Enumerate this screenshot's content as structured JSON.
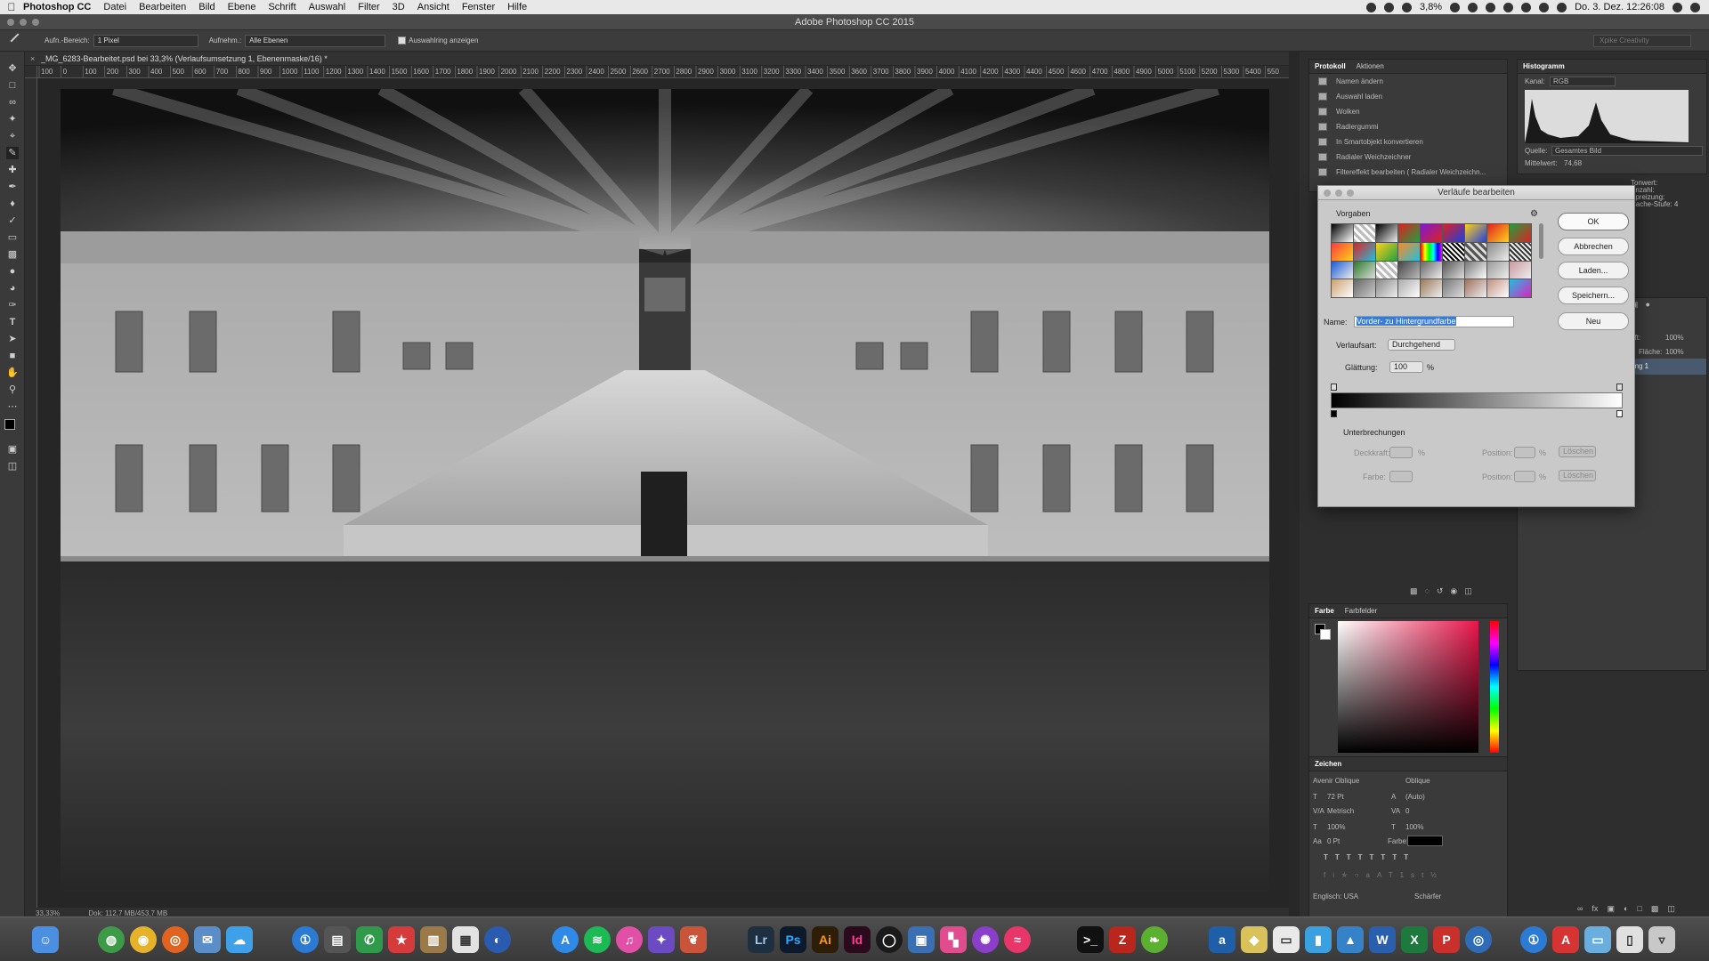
{
  "menubar": {
    "app": "Photoshop CC",
    "items": [
      "Datei",
      "Bearbeiten",
      "Bild",
      "Ebene",
      "Schrift",
      "Auswahl",
      "Filter",
      "3D",
      "Ansicht",
      "Fenster",
      "Hilfe"
    ],
    "battery": "3,8%",
    "clock": "Do. 3. Dez. 12:26:08"
  },
  "window": {
    "title": "Adobe Photoshop CC 2015"
  },
  "options": {
    "sample_label": "Aufn.-Bereich:",
    "sample_value": "1 Pixel",
    "take_label": "Aufnehm.:",
    "take_value": "Alle Ebenen",
    "ring_label": "Auswahlring anzeigen",
    "workspace": "Xpike Creativity"
  },
  "document": {
    "tab": "_MG_6283-Bearbeitet.psd bei 33,3% (Verlaufsumsetzung 1, Ebenenmaske/16) *",
    "zoom": "33,33%",
    "status": "Dok: 112,7 MB/453,7 MB"
  },
  "ruler": {
    "labels": [
      "100",
      "0",
      "100",
      "200",
      "300",
      "400",
      "500",
      "600",
      "700",
      "800",
      "900",
      "1000",
      "1100",
      "1200",
      "1300",
      "1400",
      "1500",
      "1600",
      "1700",
      "1800",
      "1900",
      "2000",
      "2100",
      "2200",
      "2300",
      "2400",
      "2500",
      "2600",
      "2700",
      "2800",
      "2900",
      "3000",
      "3100",
      "3200",
      "3300",
      "3400",
      "3500",
      "3600",
      "3700",
      "3800",
      "3900",
      "4000",
      "4100",
      "4200",
      "4300",
      "4400",
      "4500",
      "4600",
      "4700",
      "4800",
      "4900",
      "5000",
      "5100",
      "5200",
      "5300",
      "5400",
      "550"
    ]
  },
  "history": {
    "tabs": [
      "Protokoll",
      "Aktionen"
    ],
    "items": [
      "Namen ändern",
      "Auswahl laden",
      "Wolken",
      "Radiergummi",
      "In Smartobjekt konvertieren",
      "Radialer Weichzeichner",
      "Filtereffekt bearbeiten ( Radialer Weichzeichn..."
    ]
  },
  "histogram": {
    "title": "Histogramm",
    "channel_label": "Kanal:",
    "channel": "RGB",
    "source_label": "Quelle:",
    "source": "Gesamtes Bild",
    "mean_label": "Mittelwert:",
    "mean": "74,68",
    "right_labels": [
      "Tonwert:",
      "Anzahl:",
      "Spreizung:",
      "Cache-Stufe: 4"
    ]
  },
  "dialog": {
    "title": "Verläufe bearbeiten",
    "presets_label": "Vorgaben",
    "buttons": {
      "ok": "OK",
      "cancel": "Abbrechen",
      "load": "Laden...",
      "save": "Speichern...",
      "new": "Neu"
    },
    "name_label": "Name:",
    "name_value": "Vorder- zu Hintergrundfarbe",
    "type_label": "Verlaufsart:",
    "type_value": "Durchgehend",
    "smooth_label": "Glättung:",
    "smooth_value": "100",
    "smooth_unit": "%",
    "stops_label": "Unterbrechungen",
    "opacity_label": "Deckkraft:",
    "color_label": "Farbe:",
    "position_label": "Position:",
    "delete_label": "Löschen",
    "percent": "%"
  },
  "layers_partial": {
    "opacity_label": "eckkraft:",
    "opacity": "100%",
    "fill_label": "Fläche:",
    "fill": "100%",
    "layer_name": "erzung 1",
    "layer_suffix": "1"
  },
  "color_panel": {
    "tabs": [
      "Farbe",
      "Farbfelder"
    ]
  },
  "character": {
    "title": "Zeichen",
    "font": "Avenir Oblique",
    "style": "Oblique",
    "size": "72 Pt",
    "leading": "(Auto)",
    "kerning": "Metrisch",
    "tracking": "0",
    "vscale": "100%",
    "hscale": "100%",
    "baseline": "0 Pt",
    "color_label": "Farbe:",
    "language": "Englisch: USA",
    "aa": "Schärfer"
  },
  "dock": {
    "labels": [
      "Lr",
      "Ps",
      "Ai",
      "Id",
      "W",
      "X"
    ]
  }
}
